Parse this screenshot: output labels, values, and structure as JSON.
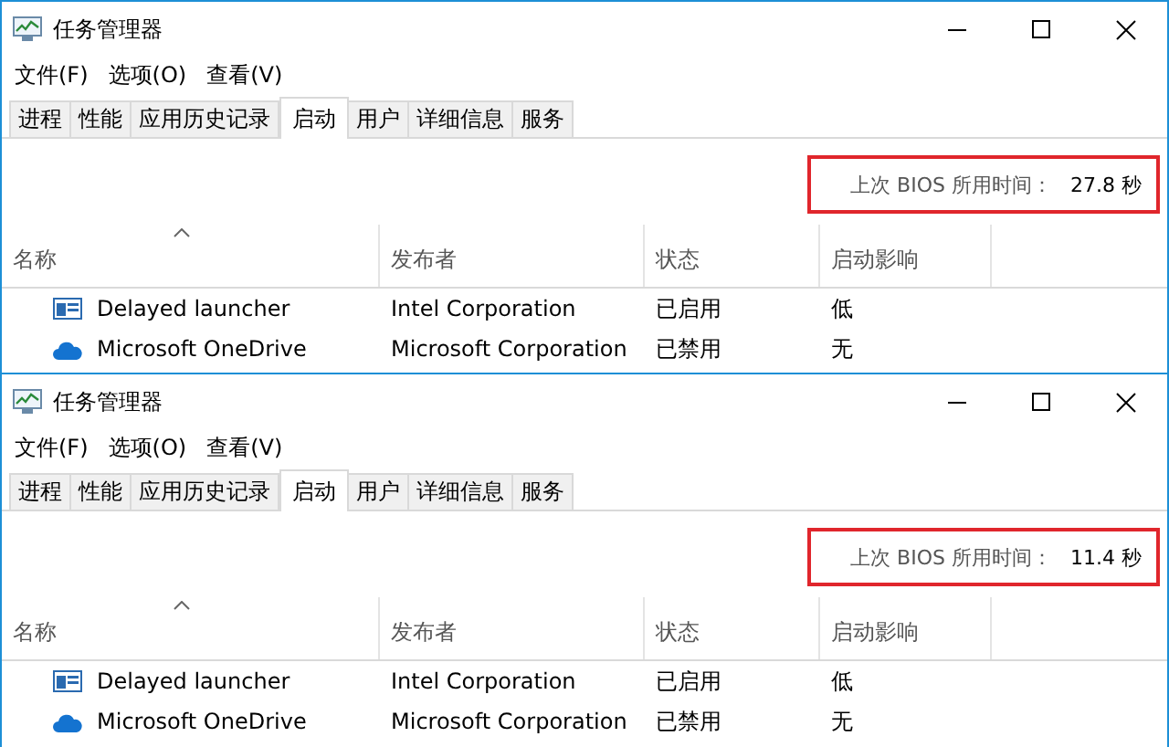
{
  "windows": [
    {
      "title": "任务管理器",
      "menu": [
        "文件(F)",
        "选项(O)",
        "查看(V)"
      ],
      "tabs": [
        {
          "label": "进程",
          "selected": false
        },
        {
          "label": "性能",
          "selected": false
        },
        {
          "label": "应用历史记录",
          "selected": false
        },
        {
          "label": "启动",
          "selected": true
        },
        {
          "label": "用户",
          "selected": false
        },
        {
          "label": "详细信息",
          "selected": false
        },
        {
          "label": "服务",
          "selected": false
        }
      ],
      "bios": {
        "label": "上次 BIOS 所用时间：",
        "value": "27.8 秒"
      },
      "columns": [
        "名称",
        "发布者",
        "状态",
        "启动影响"
      ],
      "rows": [
        {
          "kind": "window",
          "name": "Delayed launcher",
          "publisher": "Intel Corporation",
          "status": "已启用",
          "impact": "低"
        },
        {
          "kind": "cloud",
          "name": "Microsoft OneDrive",
          "publisher": "Microsoft Corporation",
          "status": "已禁用",
          "impact": "无"
        }
      ]
    },
    {
      "title": "任务管理器",
      "menu": [
        "文件(F)",
        "选项(O)",
        "查看(V)"
      ],
      "tabs": [
        {
          "label": "进程",
          "selected": false
        },
        {
          "label": "性能",
          "selected": false
        },
        {
          "label": "应用历史记录",
          "selected": false
        },
        {
          "label": "启动",
          "selected": true
        },
        {
          "label": "用户",
          "selected": false
        },
        {
          "label": "详细信息",
          "selected": false
        },
        {
          "label": "服务",
          "selected": false
        }
      ],
      "bios": {
        "label": "上次 BIOS 所用时间：",
        "value": "11.4 秒"
      },
      "columns": [
        "名称",
        "发布者",
        "状态",
        "启动影响"
      ],
      "rows": [
        {
          "kind": "window",
          "name": "Delayed launcher",
          "publisher": "Intel Corporation",
          "status": "已启用",
          "impact": "低"
        },
        {
          "kind": "cloud",
          "name": "Microsoft OneDrive",
          "publisher": "Microsoft Corporation",
          "status": "已禁用",
          "impact": "无"
        }
      ]
    }
  ]
}
